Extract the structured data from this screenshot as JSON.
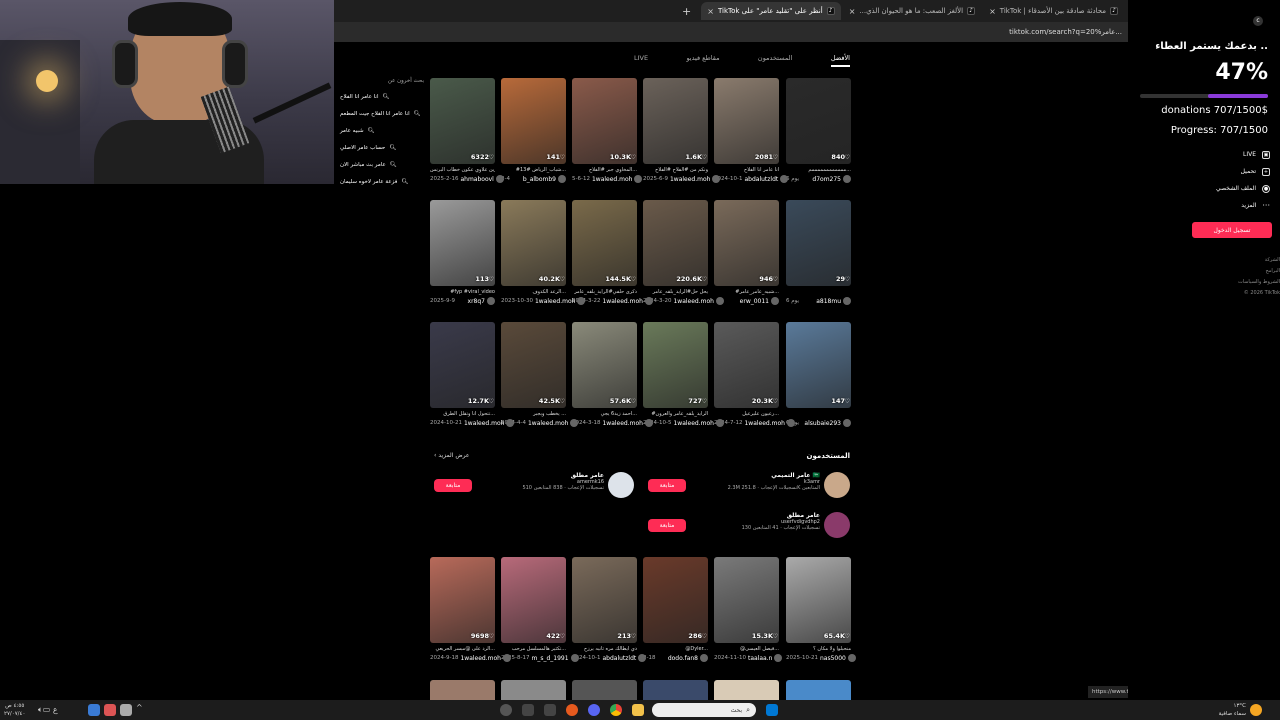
{
  "browser": {
    "tabs": [
      {
        "label": "محادثة صادقة بين الأصدقاء | TikTok",
        "active": false
      },
      {
        "label": "الألغز الصعب: ما هو الحيوان الذي...",
        "active": false
      },
      {
        "label": "أنظر على \"تقليد عامر\" على TikTok",
        "active": true
      }
    ],
    "new_tab": "+",
    "url": "tiktok.com/search?q=عامر%20..."
  },
  "search": {
    "tabs": [
      "الأفضل",
      "المستخدمون",
      "مقاطع فيديو",
      "LIVE"
    ],
    "active_tab": "الأفضل",
    "related_title": "بحث آخرون عن",
    "related": [
      "انا عامر انا الفلاح",
      "انا عامر انا الفلاح جيت المطعم",
      "شبيه عامر",
      "حساب عامر الاصلي",
      "عامر بث مباشر الان",
      "فزعة عامر لاخوه سليمان"
    ]
  },
  "videos_row1": [
    {
      "count": "840",
      "caption": "ممممممممممممم...",
      "user": "d7om275",
      "date": "6 يوم",
      "color": "#2a2a2a"
    },
    {
      "count": "2081",
      "caption": "انا عامر انا الفلاح",
      "user": "abdalutzldt",
      "date": "2024-10-1",
      "color": "#8a7b6d"
    },
    {
      "count": "1.6K",
      "caption": "ونكم من #الفلاح #الفلاح",
      "user": "1waleed.moh",
      "date": "2025-6-9",
      "color": "#6b625a"
    },
    {
      "count": "10.3K",
      "caption": "المخاوي جبر #الفلاح...",
      "user": "1waleed.moh",
      "date": "5-6-12",
      "color": "#8a5a4a"
    },
    {
      "count": "141",
      "caption": "#شباب_الرياض #13...",
      "user": "b_albomb9",
      "date": "2-4",
      "color": "#b86a3a"
    },
    {
      "count": "6322",
      "caption": "الزين علاوي عكون خطاب البرنس",
      "user": "ahmaboovl",
      "date": "2025-2-16",
      "color": "#4a5a4a"
    }
  ],
  "videos_row2": [
    {
      "count": "29",
      "caption": "",
      "user": "a818mu",
      "date": "6 يوم",
      "color": "#3a4a5a"
    },
    {
      "count": "946",
      "caption": "#شبيه_عامر_عامر...",
      "user": "erw_0011",
      "date": "",
      "color": "#7a6a5a"
    },
    {
      "count": "220.6K",
      "caption": "يحل حل#الرايد_بلقه_عامر",
      "user": "1waleed.moh",
      "date": "2024-3-20",
      "color": "#6a5a4a"
    },
    {
      "count": "144.5K",
      "caption": "ذكرى حلفي#الرايد_بلقه_عامر",
      "user": "1waleed.moh",
      "date": "2024-3-22",
      "color": "#7a6a4a"
    },
    {
      "count": "40.2K",
      "caption": "الرعد الكذوف...",
      "user": "1waleed.moh",
      "date": "2023-10-30",
      "color": "#8a7a5a"
    },
    {
      "count": "113",
      "caption": "#fyp #viral_video",
      "user": "xr8q7",
      "date": "2025-9-9",
      "color": "#9a9a9a"
    }
  ],
  "videos_row3": [
    {
      "count": "147",
      "caption": "",
      "user": "alsubaie293",
      "date": "6 يوم",
      "color": "#5a7a9a"
    },
    {
      "count": "20.3K",
      "caption": "رعيون عليرعيل...",
      "user": "1waleed.moh",
      "date": "2024-7-12",
      "color": "#5a5a5a"
    },
    {
      "count": "727",
      "caption": "#الرايد_بلقه_عامر والعرون",
      "user": "1waleed.moh",
      "date": "2024-10-5",
      "color": "#6a7a5a"
    },
    {
      "count": "57.6K",
      "caption": "احمد زيد6 يجي...",
      "user": "1waleed.moh",
      "date": "2024-3-18",
      "color": "#8a8a7a"
    },
    {
      "count": "42.5K",
      "caption": "يخطب ويجبر ...",
      "user": "1waleed.moh",
      "date": "2024-4-4",
      "color": "#5a4a3a"
    },
    {
      "count": "12.7K",
      "caption": "تتحول انا وتقلل الطرق...",
      "user": "1waleed.moh",
      "date": "2024-10-21",
      "color": "#3a3a4a"
    }
  ],
  "users": {
    "title": "المستخدمون",
    "more": "عرض المزيد",
    "list": [
      {
        "name": "عامر التميمي 🇸🇦",
        "id": "k3amr",
        "stats": "2.3M تسجيلات الإعجاب · 251.8K المتابعين",
        "follow": "متابعة"
      },
      {
        "name": "عامر مطلق",
        "id": "amermk16",
        "stats": "510 تسجيلات الإعجاب · 838 المتابعين",
        "follow": "متابعة"
      },
      {
        "name": "عامر مطلق",
        "id": "userfvdigvdhp2",
        "stats": "130 تسجيلات الإعجاب · 41 المتابعين",
        "follow": "متابعة"
      }
    ]
  },
  "videos_row4": [
    {
      "count": "65.4K",
      "caption": "منحبلوا ولا مكان ؟",
      "user": "nas5000",
      "date": "2025-10-21",
      "color": "#aaaaaa"
    },
    {
      "count": "15.3K",
      "caption": "@فيصل العيسى...",
      "user": "taalaa.n",
      "date": "2024-11-10",
      "color": "#7a7a7a"
    },
    {
      "count": "286",
      "caption": "@Dyler...",
      "user": "dodo.fan8",
      "date": "2-18",
      "color": "#6a3a2a"
    },
    {
      "count": "213",
      "caption": "دي ايطالك مره ثانيه يرزح",
      "user": "abdalutzldt",
      "date": "2024-10-1",
      "color": "#7a6a5a"
    },
    {
      "count": "422",
      "caption": "تكثير هالمسلسل مرحب...",
      "user": "m_s_d_1991",
      "date": "2025-8-17",
      "color": "#b86a7a"
    },
    {
      "count": "9698",
      "caption": "الرد على @مبسر الحربعي...",
      "user": "1waleed.moh",
      "date": "2024-9-18",
      "color": "#b86a5a"
    }
  ],
  "status_url": "https://www.tiktok.com/@1waleed.moh/video/7513715569523297543",
  "donation": {
    "title": "بدعمك يستمر العطاء ..",
    "percent": "47%",
    "progress_fraction": 0.47,
    "donations": "donations 707/1500$",
    "progress": "Progress: 707/1500"
  },
  "sidebar_menu": [
    {
      "label": "LIVE",
      "icon": "live-icon"
    },
    {
      "label": "تحميل",
      "icon": "upload-icon"
    },
    {
      "label": "الملف الشخصي",
      "icon": "profile-icon"
    },
    {
      "label": "المزيد",
      "icon": "more-icon"
    }
  ],
  "login_button": "تسجيل الدخول",
  "footer_links": [
    "الشركة",
    "البرامج",
    "الشروط والسياسات",
    "© 2026 TikTok"
  ],
  "taskbar": {
    "search_placeholder": "بحث",
    "time": "٤:٥٥ ص",
    "date": "٢٧/٠٧/٤٠",
    "weather_temp": "١٣°C",
    "weather_desc": "سماء صافية"
  }
}
